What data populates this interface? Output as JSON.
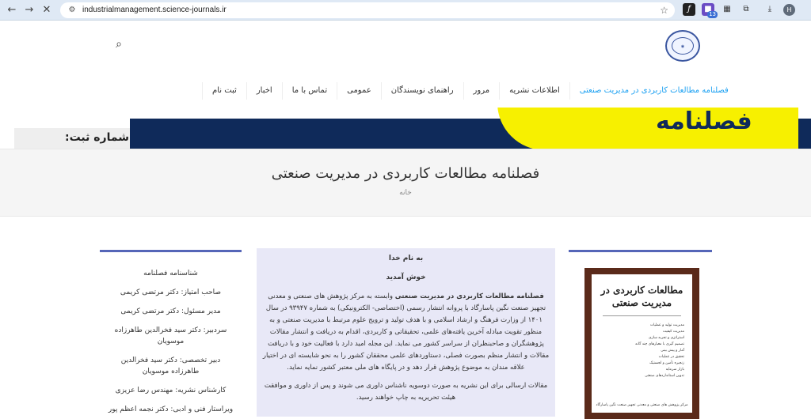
{
  "browser": {
    "url": "industrialmanagement.science-journals.ir",
    "profile_initial": "H",
    "ext_badge": "13"
  },
  "site": {
    "menu": [
      "فصلنامه مطالعات کاربردی در مدیریت صنعتی",
      "اطلاعات نشریه",
      "مرور",
      "راهنمای نویسندگان",
      "عمومی",
      "تماس با ما",
      "اخبار",
      "ثبت نام"
    ],
    "banner_big": "فصلنامه",
    "banner_small": "شماره ثبت:"
  },
  "title_area": {
    "title": "فصلنامه مطالعات کاربردی در مدیریت صنعتی",
    "breadcrumb": "خانه"
  },
  "left_panel": {
    "items": [
      "شناسنامه فصلنامه",
      "صاحب امتیاز: دکتر مرتضی کریمی",
      "مدیر مسئول: دکتر مرتضی کریمی",
      "سردبیر: دکتر سید فخرالدین طاهرزاده موسویان",
      "دبیر تخصصی: دکتر سید فخرالدین طاهرزاده موسویان",
      "کارشناس نشریه: مهندس رضا عزیزی",
      "ویراستار فنی و ادبی: دکتر نجمه اعظم پور"
    ]
  },
  "middle_panel": {
    "heading1": "به نام خدا",
    "heading2": "خوش آمدید",
    "para1_bold": "فصلنامه مطالعات کاربردی در مدیریت صنعتی",
    "para1": " وابسته به مرکز پژوهش های صنعتی و معدنی تجهیز صنعت نگین پاسارگاد با پروانه انتشار رسمی (اختصاصی- الکترونیکی) به شماره ۹۳۹۴۷ در سال ۱۴۰۱ از وزارت فرهنگ و ارشاد اسلامی و با هدف تولید و ترویج علوم مرتبط با مدیریت صنعتی و به منظور تقویت مبادله آخرین یافته‌های علمی، تحقیقاتی و کاربردی، اقدام به دریافت و انتشار مقالات پژوهشگران و صاحبنظران از سراسر کشور می نماید. این مجله امید دارد با فعالیت خود و با دریافت مقالات و انتشار منظم بصورت فصلی، دستاوردهای علمی  محققان کشور را به نحو شایسته ای در اختیار علاقه مندان به موضوع پژوهش قرار دهد و در پایگاه های ملی معتبر کشور نمایه نماید.",
    "para2": "مقالات ارسالی برای این نشریه به صورت دوسویه ناشناس داوری می شوند و پس از داوری و موافقت هیئت تحریریه به چاپ خواهند رسید."
  },
  "right_panel": {
    "cover_title": "مطالعات کاربردی در مدیریت صنعتی",
    "cover_items": [
      "مدیریت تولید و عملیات",
      "مدیریت کیفیت",
      "استراتژی و تجربه سازی",
      "تصمیم گیری با معیارهای چند گانه",
      "آمار و پیش بینی",
      "تحقیق در عملیات",
      "زنجیره تأمین و لجستیک",
      "بازار سرمایه",
      "تدوین استانداردهای صنعتی"
    ],
    "cover_foot": "مرکز پژوهش های صنعتی و معدنی تجهیز صنعت نگین پاسارگاد"
  }
}
